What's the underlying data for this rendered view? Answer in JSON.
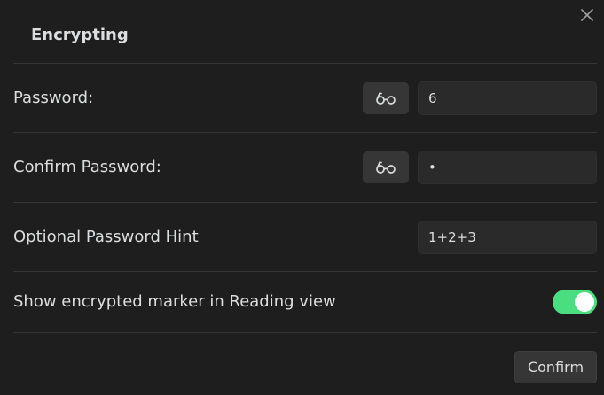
{
  "dialog": {
    "title": "Encrypting"
  },
  "rows": {
    "password": {
      "label": "Password:",
      "value": "6"
    },
    "confirm_password": {
      "label": "Confirm Password:",
      "value_masked": "•"
    },
    "hint": {
      "label": "Optional Password Hint",
      "value": "1+2+3"
    },
    "marker": {
      "label": "Show encrypted marker in Reading view",
      "enabled": true
    }
  },
  "footer": {
    "confirm_label": "Confirm"
  },
  "colors": {
    "background": "#1e1e1e",
    "toggle_on": "#4ade80",
    "button_bg": "#363636"
  },
  "icons": {
    "close": "close-icon",
    "reveal": "glasses-icon"
  }
}
